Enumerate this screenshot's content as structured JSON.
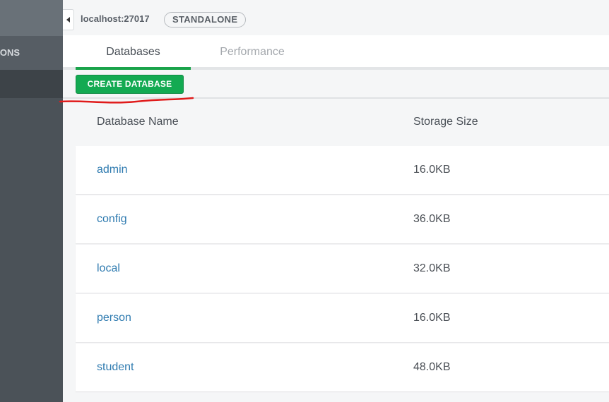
{
  "sidebar": {
    "section_label": "ONS"
  },
  "header": {
    "host": "localhost:27017",
    "topology_badge": "STANDALONE"
  },
  "tabs": [
    {
      "label": "Databases",
      "active": true
    },
    {
      "label": "Performance",
      "active": false
    }
  ],
  "toolbar": {
    "create_label": "CREATE DATABASE"
  },
  "table": {
    "columns": [
      "Database Name",
      "Storage Size"
    ],
    "rows": [
      {
        "name": "admin",
        "size": "16.0KB"
      },
      {
        "name": "config",
        "size": "36.0KB"
      },
      {
        "name": "local",
        "size": "32.0KB"
      },
      {
        "name": "person",
        "size": "16.0KB"
      },
      {
        "name": "student",
        "size": "48.0KB"
      }
    ]
  },
  "colors": {
    "accent": "#13aa52",
    "link": "#2f7bb0",
    "annotation": "#e01b1b"
  }
}
